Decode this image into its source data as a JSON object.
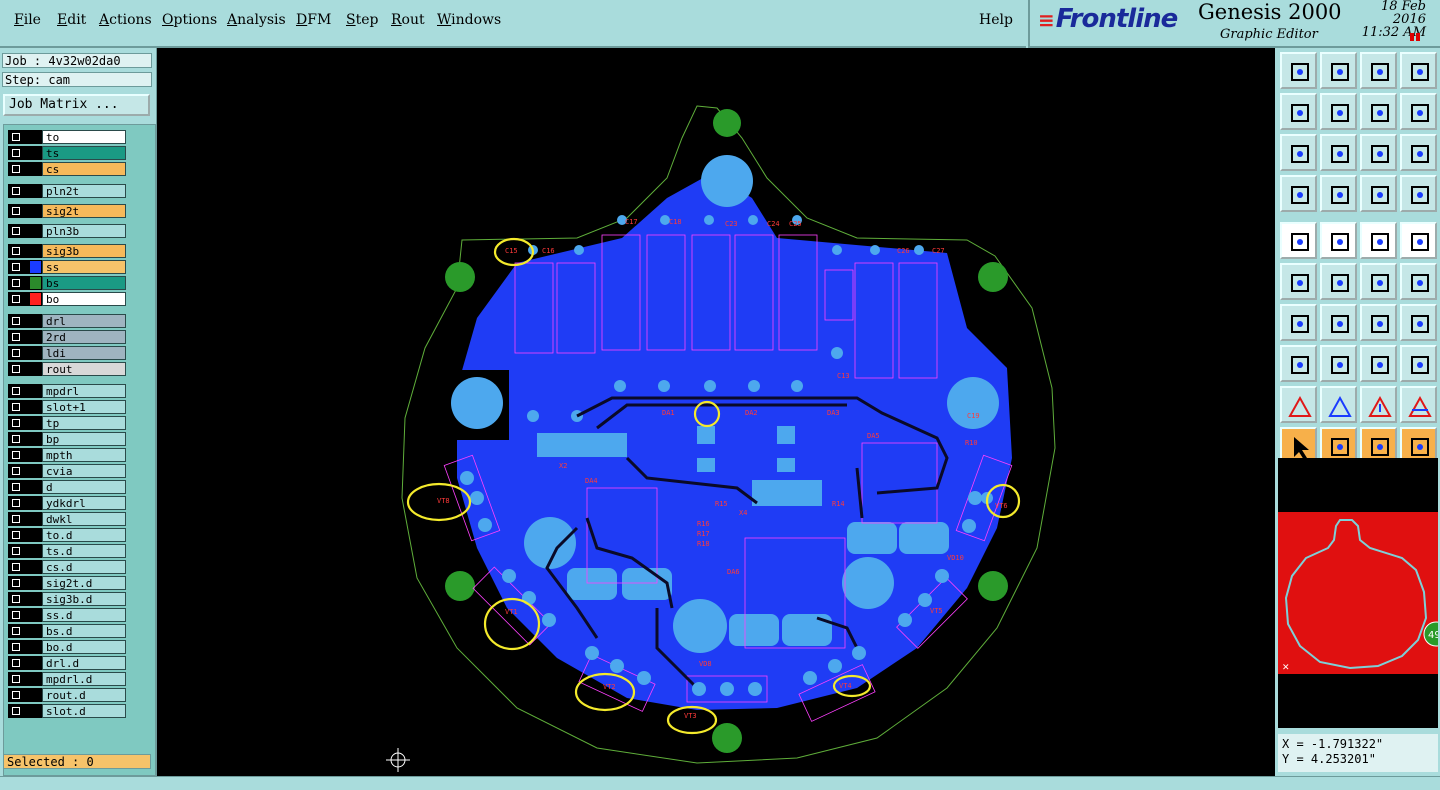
{
  "menu": {
    "items": [
      "File",
      "Edit",
      "Actions",
      "Options",
      "Analysis",
      "DFM",
      "Step",
      "Rout",
      "Windows"
    ],
    "help": "Help"
  },
  "brand": {
    "logo": "Frontline",
    "product": "Genesis 2000",
    "subtitle": "Graphic Editor",
    "date": "18 Feb 2016",
    "time": "11:32 AM"
  },
  "job": {
    "job_line": "Job : 4v32w02da0",
    "step_line": "Step: cam",
    "matrix_button": "Job Matrix ..."
  },
  "layers": [
    {
      "name": "to",
      "color": "#ffffff"
    },
    {
      "name": "ts",
      "color": "#1a9a84"
    },
    {
      "name": "cs",
      "color": "#f6b95a"
    },
    {
      "name": "pln2t",
      "color": "#a9dcdc"
    },
    {
      "name": "sig2t",
      "color": "#f6b95a"
    },
    {
      "name": "pln3b",
      "color": "#a9dcdc"
    },
    {
      "name": "sig3b",
      "color": "#f6b95a"
    },
    {
      "name": "ss",
      "color": "#f6c36a",
      "swatch": "#1a3cff"
    },
    {
      "name": "bs",
      "color": "#1a9a84",
      "swatch": "#2b8a2b"
    },
    {
      "name": "bo",
      "color": "#ffffff",
      "swatch": "#ff2020"
    },
    {
      "name": "drl",
      "color": "#9fb4c0"
    },
    {
      "name": "2rd",
      "color": "#9fb4c0"
    },
    {
      "name": "ldi",
      "color": "#9fb4c0"
    },
    {
      "name": "rout",
      "color": "#d8d8d8"
    },
    {
      "name": "mpdrl",
      "color": "#a9dcdc"
    },
    {
      "name": "slot+1",
      "color": "#a9dcdc"
    },
    {
      "name": "tp",
      "color": "#a9dcdc"
    },
    {
      "name": "bp",
      "color": "#a9dcdc"
    },
    {
      "name": "mpth",
      "color": "#a9dcdc"
    },
    {
      "name": "cvia",
      "color": "#a9dcdc"
    },
    {
      "name": "d",
      "color": "#a9dcdc"
    },
    {
      "name": "ydkdrl",
      "color": "#a9dcdc"
    },
    {
      "name": "dwkl",
      "color": "#a9dcdc"
    },
    {
      "name": "to.d",
      "color": "#a9dcdc"
    },
    {
      "name": "ts.d",
      "color": "#a9dcdc"
    },
    {
      "name": "cs.d",
      "color": "#a9dcdc"
    },
    {
      "name": "sig2t.d",
      "color": "#a9dcdc"
    },
    {
      "name": "sig3b.d",
      "color": "#a9dcdc"
    },
    {
      "name": "ss.d",
      "color": "#a9dcdc"
    },
    {
      "name": "bs.d",
      "color": "#a9dcdc"
    },
    {
      "name": "bo.d",
      "color": "#a9dcdc"
    },
    {
      "name": "drl.d",
      "color": "#a9dcdc"
    },
    {
      "name": "mpdrl.d",
      "color": "#a9dcdc"
    },
    {
      "name": "rout.d",
      "color": "#a9dcdc"
    },
    {
      "name": "slot.d",
      "color": "#a9dcdc"
    }
  ],
  "selected": "Selected : 0",
  "coords": {
    "x_line": "X = -1.791322\"",
    "y_line": "Y = 4.253201\""
  },
  "preview_badge": "49",
  "pcb_labels": [
    "C15",
    "C16",
    "C17",
    "C18",
    "C23",
    "C24",
    "C25",
    "C26",
    "C27",
    "DA1",
    "DA2",
    "DA3",
    "DA4",
    "DA5",
    "DA6",
    "VT8",
    "VT1",
    "VT2",
    "VT3",
    "VT4",
    "VT5",
    "VT6",
    "R10",
    "R14",
    "R15",
    "R16",
    "R17",
    "R18",
    "VD8",
    "VD10",
    "X2",
    "X4",
    "C13",
    "C19"
  ]
}
